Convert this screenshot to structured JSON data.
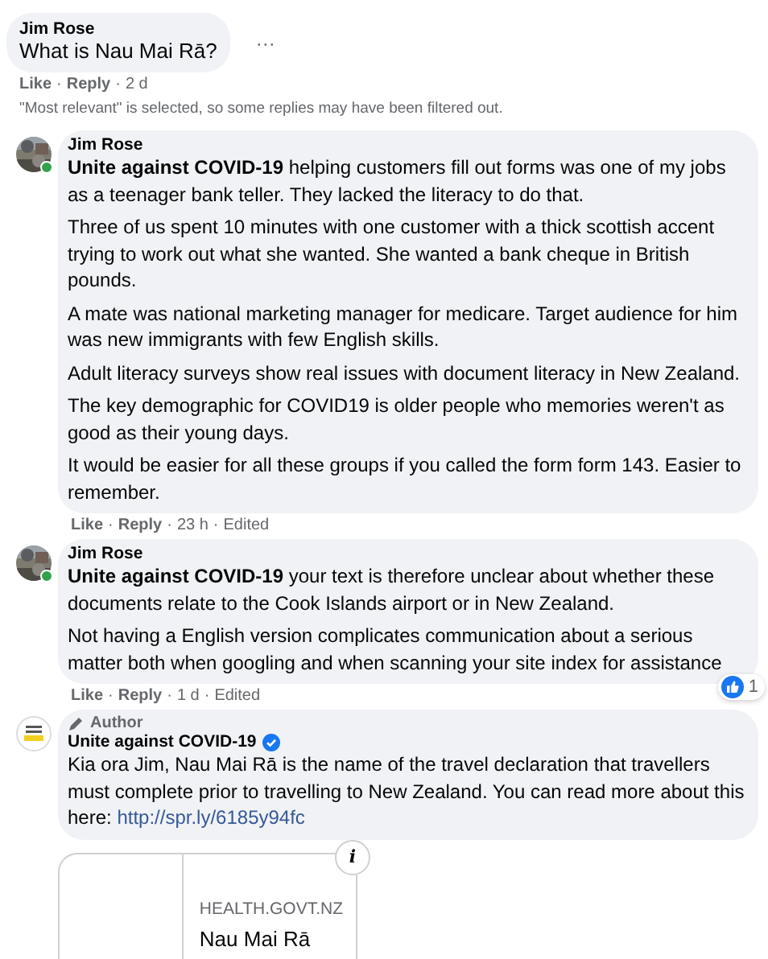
{
  "top_comment": {
    "author": "Jim Rose",
    "text": "What is Nau Mai Rā?",
    "more": "···",
    "actions": [
      {
        "kind": "link",
        "text": "Like"
      },
      {
        "kind": "link",
        "text": "Reply"
      },
      {
        "kind": "meta",
        "text": "2 d"
      }
    ]
  },
  "separator": "·",
  "notice": "\"Most relevant\" is selected, so some replies may have been filtered out.",
  "replies": [
    {
      "author": "Jim Rose",
      "online": true,
      "verified": false,
      "paragraphs": [
        "**Unite against COVID-19** helping customers fill out forms was one of my jobs as a teenager bank teller. They lacked the literacy to do that.",
        "Three of us spent 10 minutes with one customer with a thick scottish accent trying to work out what she wanted. She wanted a bank cheque in British pounds.",
        "A mate was national marketing manager for medicare. Target audience for him was new immigrants with few English skills.",
        "Adult literacy surveys show real issues with document literacy in New Zealand.",
        "The key demographic for COVID19 is older people who memories weren't as good as their young days.",
        "It would be easier for all these groups if you called the form form 143. Easier to remember."
      ],
      "actions": [
        {
          "kind": "link",
          "text": "Like"
        },
        {
          "kind": "link",
          "text": "Reply"
        },
        {
          "kind": "meta",
          "text": "23 h"
        },
        {
          "kind": "meta",
          "text": "Edited"
        }
      ]
    },
    {
      "author": "Jim Rose",
      "online": true,
      "verified": false,
      "paragraphs": [
        "**Unite against COVID-19** your text is therefore unclear about whether these documents relate to the Cook Islands airport or in New Zealand.",
        "Not having a English version complicates communication about a serious matter both when googling and when scanning your site index for assistance"
      ],
      "reactions": "1",
      "actions": [
        {
          "kind": "link",
          "text": "Like"
        },
        {
          "kind": "link",
          "text": "Reply"
        },
        {
          "kind": "meta",
          "text": "1 d"
        },
        {
          "kind": "meta",
          "text": "Edited"
        }
      ]
    },
    {
      "author": "Unite against COVID-19",
      "kind": "logo",
      "online": false,
      "author_badge": "Author",
      "verified": true,
      "paragraphs": [
        "Kia ora Jim, Nau Mai Rā is the name of the travel declaration that travellers must complete prior to travelling to New Zealand. You can read more about this here: "
      ],
      "link": "http://spr.ly/6185y94fc",
      "link_card": {
        "domain": "HEALTH.GOVT.NZ",
        "title": "Nau Mai Rā",
        "info": "i"
      }
    }
  ]
}
